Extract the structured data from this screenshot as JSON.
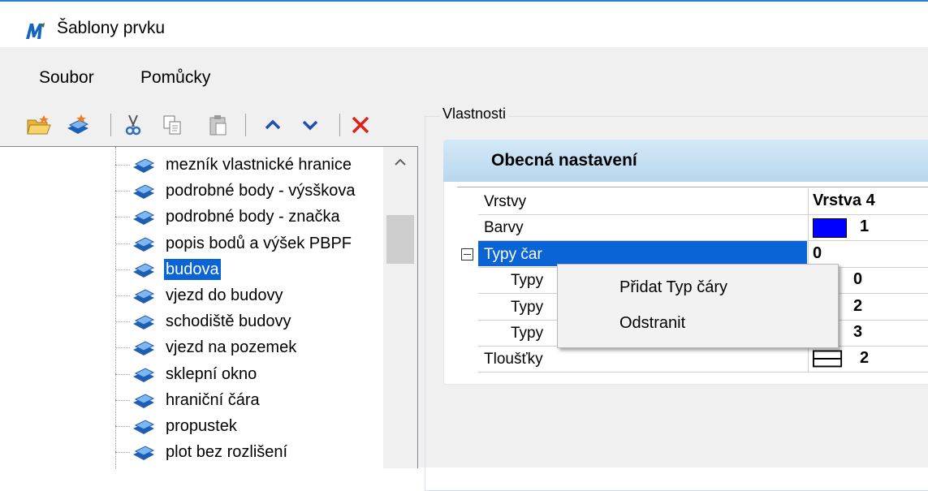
{
  "window": {
    "title": "Šablony prvku"
  },
  "menu": {
    "items": [
      "Soubor",
      "Pomůcky"
    ]
  },
  "toolbar": {
    "icons": [
      "open-folder-icon",
      "new-template-icon",
      "cut-icon",
      "copy-icon",
      "paste-icon",
      "move-up-icon",
      "move-down-icon",
      "delete-icon"
    ]
  },
  "tree": {
    "items": [
      {
        "label": "mezník vlastnické hranice",
        "selected": false
      },
      {
        "label": "podrobné body - výsškova",
        "selected": false
      },
      {
        "label": "podrobné body - značka",
        "selected": false
      },
      {
        "label": "popis bodů a výšek PBPF",
        "selected": false
      },
      {
        "label": "budova",
        "selected": true
      },
      {
        "label": "vjezd do budovy",
        "selected": false
      },
      {
        "label": "schodiště budovy",
        "selected": false
      },
      {
        "label": "vjezd na pozemek",
        "selected": false
      },
      {
        "label": "sklepní okno",
        "selected": false
      },
      {
        "label": "hraniční čára",
        "selected": false
      },
      {
        "label": "propustek",
        "selected": false
      },
      {
        "label": "plot bez rozlišení",
        "selected": false
      }
    ]
  },
  "properties": {
    "group_title": "Vlastnosti",
    "section_title": "Obecná nastavení",
    "rows": [
      {
        "name": "Vrstvy",
        "value": "Vrstva 4"
      },
      {
        "name": "Barvy",
        "value": "1",
        "color": "#0000ff"
      },
      {
        "name": "Typy čar",
        "value": "0",
        "selected": true
      },
      {
        "name": "Typy",
        "value": "0",
        "child": true
      },
      {
        "name": "Typy",
        "value": "2",
        "child": true
      },
      {
        "name": "Typy",
        "value": "3",
        "child": true
      },
      {
        "name": "Tloušťky",
        "value": "2"
      }
    ]
  },
  "context_menu": {
    "items": [
      "Přidat Typ čáry",
      "Odstranit"
    ]
  },
  "colors": {
    "selection": "#0a64d6",
    "accent": "#2a7fd4"
  }
}
